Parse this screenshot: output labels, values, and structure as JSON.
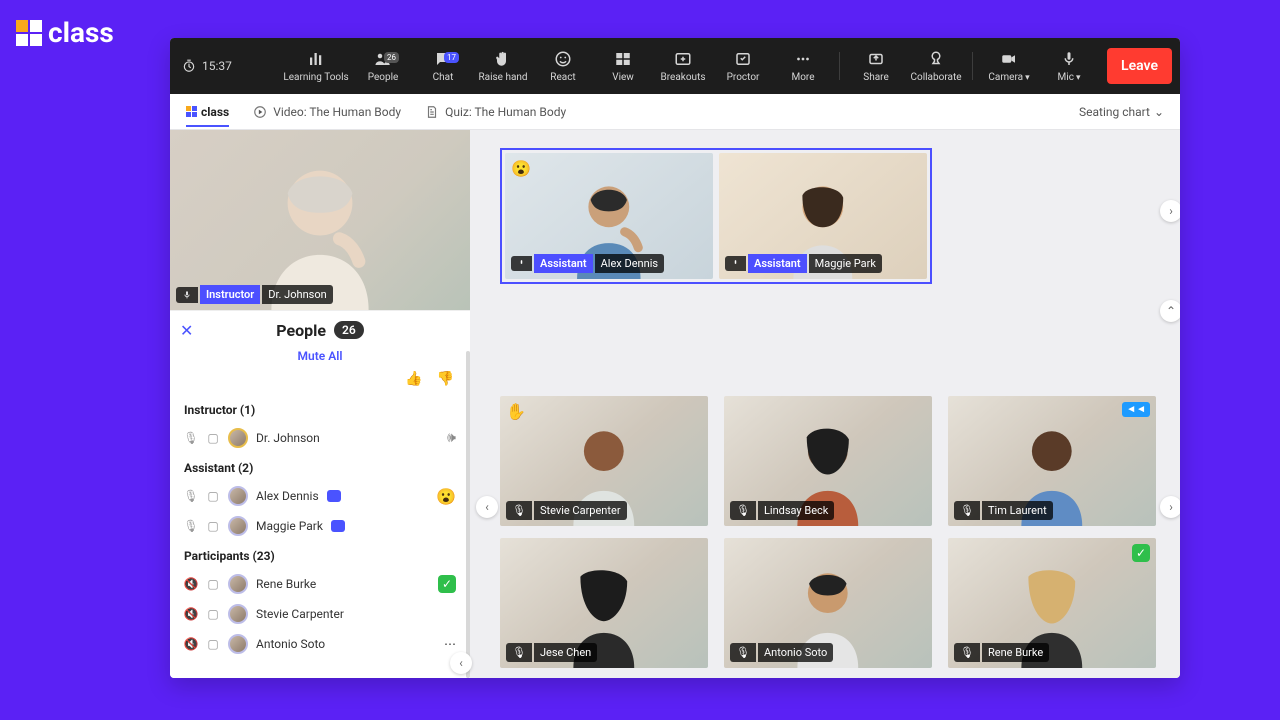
{
  "brand": "class",
  "toolbar": {
    "timer": "15:37",
    "learning_tools": "Learning Tools",
    "people": "People",
    "people_badge": "26",
    "chat": "Chat",
    "chat_badge": "17",
    "raise_hand": "Raise hand",
    "react": "React",
    "view": "View",
    "breakouts": "Breakouts",
    "proctor": "Proctor",
    "more": "More",
    "share": "Share",
    "collaborate": "Collaborate",
    "camera": "Camera",
    "mic": "Mic",
    "leave": "Leave"
  },
  "tabs": {
    "brand": "class",
    "video_tab": "Video: The Human Body",
    "quiz_tab": "Quiz: The Human Body",
    "seating": "Seating chart"
  },
  "instructor_tile": {
    "role": "Instructor",
    "name": "Dr. Johnson"
  },
  "people_panel": {
    "title": "People",
    "count": "26",
    "mute_all": "Mute All",
    "instructor_section": "Instructor (1)",
    "assistant_section": "Assistant (2)",
    "participants_section": "Participants (23)",
    "instructor": {
      "name": "Dr. Johnson"
    },
    "assistants": [
      {
        "name": "Alex Dennis",
        "reaction": "😮"
      },
      {
        "name": "Maggie Park"
      }
    ],
    "participants": [
      {
        "name": "Rene Burke",
        "check": true
      },
      {
        "name": "Stevie Carpenter"
      },
      {
        "name": "Antonio Soto"
      }
    ]
  },
  "assistants_row": [
    {
      "role": "Assistant",
      "name": "Alex Dennis",
      "reaction": "😮"
    },
    {
      "role": "Assistant",
      "name": "Maggie Park"
    }
  ],
  "grid": [
    {
      "name": "Stevie Carpenter",
      "hand": true
    },
    {
      "name": "Lindsay Beck"
    },
    {
      "name": "Tim Laurent",
      "cc": "◄◄"
    },
    {
      "name": "Jese Chen"
    },
    {
      "name": "Antonio Soto"
    },
    {
      "name": "Rene Burke",
      "check": true
    }
  ]
}
